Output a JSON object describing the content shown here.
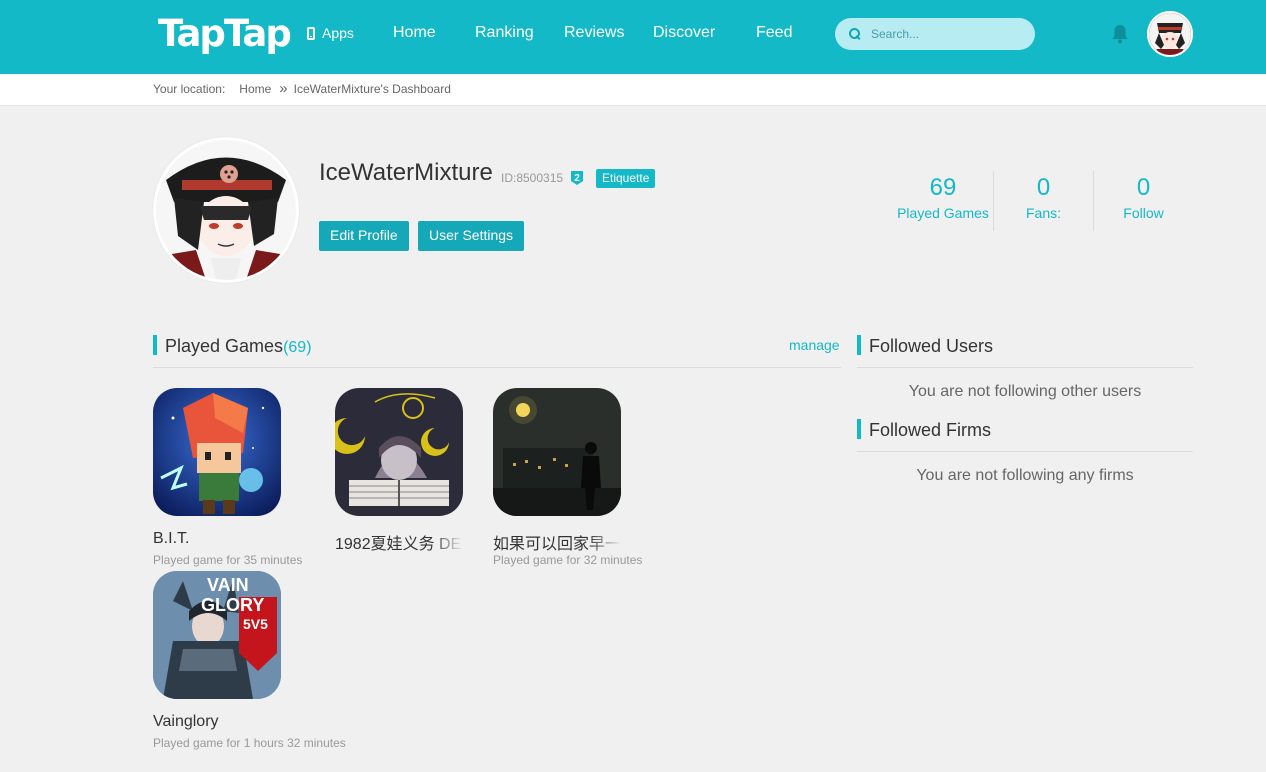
{
  "header": {
    "logo": "TapTap",
    "apps_label": "Apps",
    "nav": [
      "Home",
      "Ranking",
      "Reviews",
      "Discover",
      "Feed"
    ],
    "search_placeholder": "Search...",
    "brand_color": "#14b9c8"
  },
  "breadcrumb": {
    "prefix": "Your location:",
    "home": "Home",
    "separator": "»",
    "current": "IceWaterMixture's Dashboard"
  },
  "profile": {
    "username": "IceWaterMixture",
    "id_label": "ID:8500315",
    "level": "2",
    "badge": "Etiquette",
    "edit_button": "Edit Profile",
    "settings_button": "User Settings",
    "stats": [
      {
        "value": "69",
        "label": "Played Games"
      },
      {
        "value": "0",
        "label": "Fans:"
      },
      {
        "value": "0",
        "label": "Follow"
      }
    ]
  },
  "played_games": {
    "title": "Played Games",
    "count": "(69)",
    "manage": "manage",
    "items": [
      {
        "name": "B.I.T.",
        "played": "Played game for 35 minutes"
      },
      {
        "name": "1982夏娃义务 DE",
        "played": ""
      },
      {
        "name": "如果可以回家早一",
        "played": "Played game for 32 minutes"
      },
      {
        "name": "Vainglory",
        "played": "Played game for 1 hours 32 minutes"
      }
    ]
  },
  "sidebar": {
    "followed_users_title": "Followed Users",
    "followed_users_empty": "You are not following other users",
    "followed_firms_title": "Followed Firms",
    "followed_firms_empty": "You are not following any firms"
  },
  "vainglory_logo": [
    "VAIN",
    "GLORY",
    "5V5"
  ]
}
